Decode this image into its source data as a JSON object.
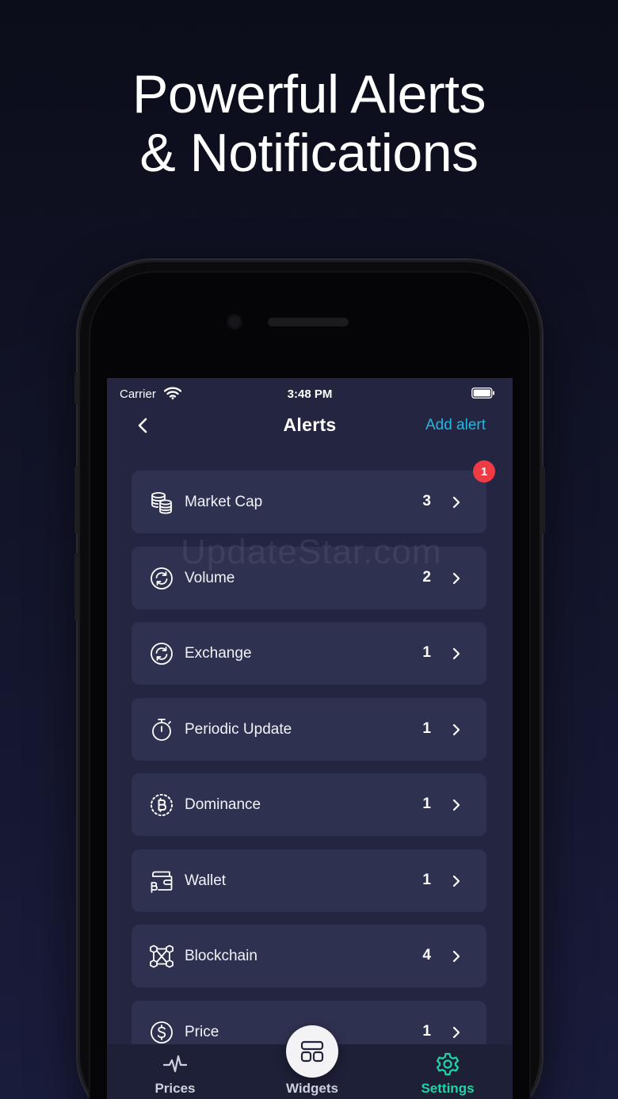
{
  "headline": {
    "line1": "Powerful Alerts",
    "line2": "& Notifications"
  },
  "status_bar": {
    "carrier": "Carrier",
    "time": "3:48 PM"
  },
  "nav": {
    "title": "Alerts",
    "add_label": "Add alert"
  },
  "alerts": [
    {
      "label": "Market Cap",
      "count": "3",
      "icon": "coins-stack-icon",
      "badge": "1"
    },
    {
      "label": "Volume",
      "count": "2",
      "icon": "refresh-circle-icon"
    },
    {
      "label": "Exchange",
      "count": "1",
      "icon": "exchange-circle-icon"
    },
    {
      "label": "Periodic Update",
      "count": "1",
      "icon": "stopwatch-icon"
    },
    {
      "label": "Dominance",
      "count": "1",
      "icon": "bitcoin-dotted-icon"
    },
    {
      "label": "Wallet",
      "count": "1",
      "icon": "wallet-icon"
    },
    {
      "label": "Blockchain",
      "count": "4",
      "icon": "blockchain-nodes-icon"
    },
    {
      "label": "Price",
      "count": "1",
      "icon": "dollar-circle-icon"
    }
  ],
  "watermark": "UpdateStar.com",
  "tabs": [
    {
      "label": "Prices",
      "icon": "pulse-icon",
      "active": false
    },
    {
      "label": "Widgets",
      "icon": "widgets-grid-icon",
      "active": false
    },
    {
      "label": "Settings",
      "icon": "gear-icon",
      "active": true
    }
  ],
  "colors": {
    "accent_link": "#28b4e0",
    "active_tab": "#1fd6a2",
    "badge": "#f03a44",
    "card": "#2f3150",
    "screen_bg": "#242641"
  }
}
